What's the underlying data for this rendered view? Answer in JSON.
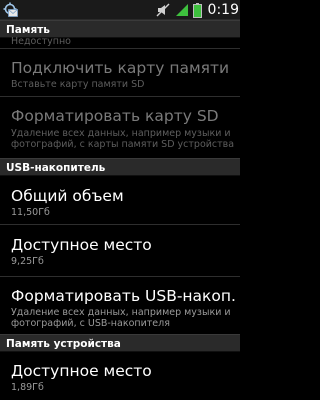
{
  "status_bar": {
    "time": "0:19",
    "icons": [
      "usb-debug-icon",
      "mail-icon",
      "mute-icon",
      "signal-icon",
      "battery-icon"
    ],
    "color": "#1a1a1a"
  },
  "sections": {
    "sd": {
      "header": "Память",
      "partial_item": "Недоступно",
      "items": [
        {
          "title": "Подключить карту памяти",
          "subtitle": "Вставьте карту памяти SD",
          "disabled": true
        },
        {
          "title": "Форматировать карту SD",
          "subtitle": "Удаление всех данных, например музыки и фотографий, с карты памяти SD устройства",
          "disabled": true
        }
      ]
    },
    "usb": {
      "header": "USB-накопитель",
      "items": [
        {
          "title": "Общий объем",
          "subtitle": "11,50Гб",
          "disabled": false
        },
        {
          "title": "Доступное место",
          "subtitle": "9,25Гб",
          "disabled": false
        },
        {
          "title": "Форматировать USB-накоп.",
          "subtitle": "Удаление всех данных, например музыки и фотографий, с USB-накопителя",
          "disabled": false
        }
      ]
    },
    "device": {
      "header": "Память устройства",
      "items": [
        {
          "title": "Доступное место",
          "subtitle": "1,89Гб",
          "disabled": false
        }
      ]
    }
  }
}
